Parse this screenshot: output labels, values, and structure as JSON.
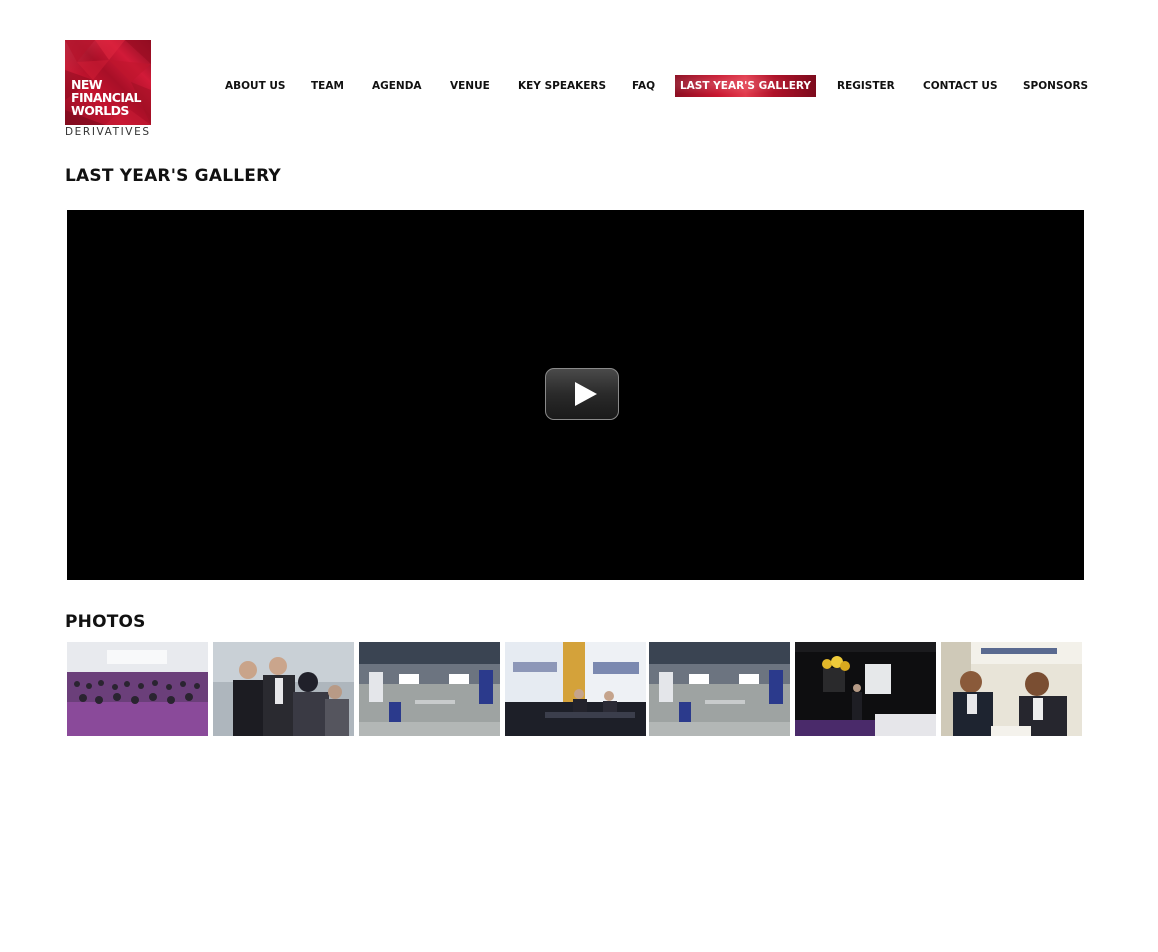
{
  "logo": {
    "lines": [
      "NEW",
      "FINANCIAL",
      "WORLDS"
    ],
    "subtitle": "DERIVATIVES"
  },
  "nav": {
    "items": [
      {
        "label": "ABOUT US",
        "active": false
      },
      {
        "label": "TEAM",
        "active": false
      },
      {
        "label": "AGENDA",
        "active": false
      },
      {
        "label": "VENUE",
        "active": false
      },
      {
        "label": "KEY SPEAKERS",
        "active": false
      },
      {
        "label": "FAQ",
        "active": false
      },
      {
        "label": "LAST YEAR'S GALLERY",
        "active": true
      },
      {
        "label": "REGISTER",
        "active": false
      },
      {
        "label": "CONTACT US",
        "active": false
      },
      {
        "label": "SPONSORS",
        "active": false
      }
    ]
  },
  "page": {
    "title": "LAST YEAR'S GALLERY",
    "photos_heading": "PHOTOS"
  },
  "colors": {
    "brand_red": "#c4142f",
    "video_bg": "#000000"
  },
  "photos": [
    {
      "subject": "conference audience hall"
    },
    {
      "subject": "attendees networking"
    },
    {
      "subject": "venue lobby overview"
    },
    {
      "subject": "panel discussion on stage"
    },
    {
      "subject": "venue lobby overview"
    },
    {
      "subject": "speaker at podium"
    },
    {
      "subject": "attendees at registration desk"
    }
  ]
}
